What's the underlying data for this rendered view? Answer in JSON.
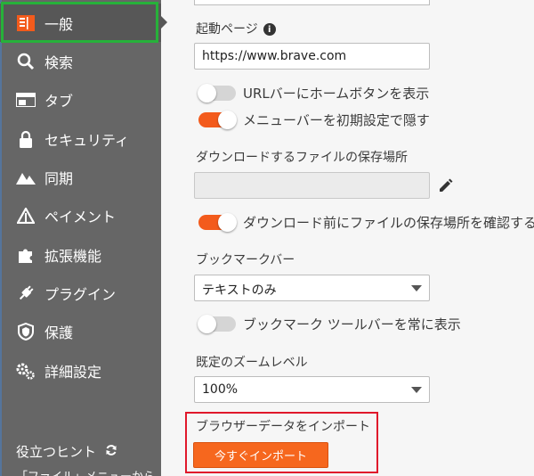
{
  "sidebar": {
    "items": [
      {
        "label": "一般",
        "icon": "general-icon"
      },
      {
        "label": "検索",
        "icon": "search-icon"
      },
      {
        "label": "タブ",
        "icon": "tab-icon"
      },
      {
        "label": "セキュリティ",
        "icon": "lock-icon"
      },
      {
        "label": "同期",
        "icon": "sync-icon"
      },
      {
        "label": "ペイメント",
        "icon": "payment-icon"
      },
      {
        "label": "拡張機能",
        "icon": "puzzle-icon"
      },
      {
        "label": "プラグイン",
        "icon": "plug-icon"
      },
      {
        "label": "保護",
        "icon": "shield-icon"
      },
      {
        "label": "詳細設定",
        "icon": "gears-icon"
      }
    ],
    "hint_title": "役立つヒント",
    "hint_text": "「ファイル」メニューから"
  },
  "main": {
    "startup_label": "起動ページ",
    "startup_url": "https://www.brave.com",
    "show_home_button": "URLバーにホームボタンを表示",
    "hide_menu_bar": "メニューバーを初期設定で隠す",
    "download_location_label": "ダウンロードするファイルの保存場所",
    "download_location_value": "",
    "ask_download_location": "ダウンロード前にファイルの保存場所を確認する",
    "bookmarks_bar_label": "ブックマークバー",
    "bookmarks_bar_value": "テキストのみ",
    "always_show_bookmarks": "ブックマーク ツールバーを常に表示",
    "zoom_label": "既定のズームレベル",
    "zoom_value": "100%",
    "import_label": "ブラウザーデータをインポート",
    "import_button": "今すぐインポート"
  },
  "toggles": {
    "show_home_button": false,
    "hide_menu_bar": true,
    "ask_download_location": true,
    "always_show_bookmarks": false
  },
  "colors": {
    "accent": "#f35b1c",
    "sidebar": "#666666",
    "active_outline": "#27b13a",
    "highlight_box": "#e0182b"
  }
}
